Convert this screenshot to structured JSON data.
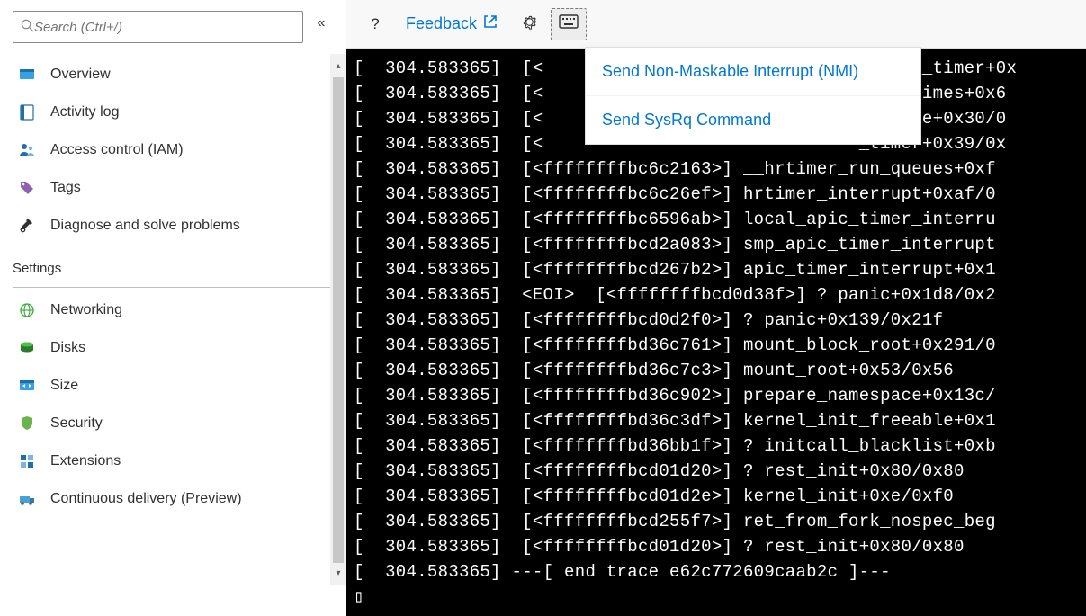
{
  "search": {
    "placeholder": "Search (Ctrl+/)"
  },
  "sidebar": {
    "items": [
      {
        "label": "Overview",
        "icon": "overview"
      },
      {
        "label": "Activity log",
        "icon": "activity-log"
      },
      {
        "label": "Access control (IAM)",
        "icon": "access-control"
      },
      {
        "label": "Tags",
        "icon": "tag"
      },
      {
        "label": "Diagnose and solve problems",
        "icon": "diagnose"
      }
    ],
    "settings_header": "Settings",
    "settings_items": [
      {
        "label": "Networking",
        "icon": "networking"
      },
      {
        "label": "Disks",
        "icon": "disks"
      },
      {
        "label": "Size",
        "icon": "size"
      },
      {
        "label": "Security",
        "icon": "security"
      },
      {
        "label": "Extensions",
        "icon": "extensions"
      },
      {
        "label": "Continuous delivery (Preview)",
        "icon": "continuous-delivery"
      }
    ]
  },
  "toolbar": {
    "help_label": "?",
    "feedback_label": "Feedback",
    "settings_icon": "gear",
    "keyboard_icon": "keyboard"
  },
  "dropdown": {
    "items": [
      "Send Non-Maskable Interrupt (NMI)",
      "Send SysRq Command"
    ]
  },
  "console": {
    "lines": [
      "[  304.583365]  [<                              hed_do_timer+0x",
      "[  304.583365]  [<                              cess_times+0x6",
      "[  304.583365]  [<                              _handle+0x30/0",
      "[  304.583365]  [<                              _timer+0x39/0x",
      "[  304.583365]  [<ffffffffbc6c2163>] __hrtimer_run_queues+0xf",
      "[  304.583365]  [<ffffffffbc6c26ef>] hrtimer_interrupt+0xaf/0",
      "[  304.583365]  [<ffffffffbc6596ab>] local_apic_timer_interru",
      "[  304.583365]  [<ffffffffbcd2a083>] smp_apic_timer_interrupt",
      "[  304.583365]  [<ffffffffbcd267b2>] apic_timer_interrupt+0x1",
      "[  304.583365]  <EOI>  [<ffffffffbcd0d38f>] ? panic+0x1d8/0x2",
      "[  304.583365]  [<ffffffffbcd0d2f0>] ? panic+0x139/0x21f",
      "[  304.583365]  [<ffffffffbd36c761>] mount_block_root+0x291/0",
      "[  304.583365]  [<ffffffffbd36c7c3>] mount_root+0x53/0x56",
      "[  304.583365]  [<ffffffffbd36c902>] prepare_namespace+0x13c/",
      "[  304.583365]  [<ffffffffbd36c3df>] kernel_init_freeable+0x1",
      "[  304.583365]  [<ffffffffbd36bb1f>] ? initcall_blacklist+0xb",
      "[  304.583365]  [<ffffffffbcd01d20>] ? rest_init+0x80/0x80",
      "[  304.583365]  [<ffffffffbcd01d2e>] kernel_init+0xe/0xf0",
      "[  304.583365]  [<ffffffffbcd255f7>] ret_from_fork_nospec_beg",
      "[  304.583365]  [<ffffffffbcd01d20>] ? rest_init+0x80/0x80",
      "[  304.583365] ---[ end trace e62c772609caab2c ]---",
      "▯"
    ]
  }
}
